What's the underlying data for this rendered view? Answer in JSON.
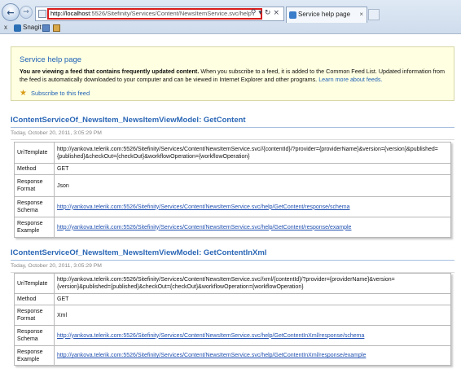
{
  "browser": {
    "address_host": "http://localhost",
    "address_path": ":5526/Sitefinity/Services/Content/NewsItemService.svc/help",
    "tab_title": "Service help page",
    "toolbar_close": "x",
    "snagit_label": "Snagit"
  },
  "banner": {
    "title": "Service help page",
    "text_bold": "You are viewing a feed that contains frequently updated content.",
    "text_rest": " When you subscribe to a feed, it is added to the Common Feed List. Updated information from the feed is automatically downloaded to your computer and can be viewed in Internet Explorer and other programs. ",
    "learn_more": "Learn more about feeds.",
    "subscribe": "Subscribe to this feed"
  },
  "operations": [
    {
      "title": "IContentServiceOf_NewsItem_NewsItemViewModel: GetContent",
      "date": "Today, October 20, 2011, 3:05:29 PM",
      "rows": [
        {
          "key": "UriTemplate",
          "value": "http://yankova.telerik.com:5526/Sitefinity/Services/Content/NewsItemService.svc//{contentId}/?provider={providerName}&version={version}&published={published}&checkOut={checkOut}&workflowOperation={workflowOperation}"
        },
        {
          "key": "Method",
          "value": "GET"
        },
        {
          "key": "Response Format",
          "value": "Json"
        },
        {
          "key": "Response Schema",
          "value": "http://yankova.telerik.com:5526/Sitefinity/Services/Content/NewsItemService.svc/help/GetContent/response/schema"
        },
        {
          "key": "Response Example",
          "value": "http://yankova.telerik.com:5526/Sitefinity/Services/Content/NewsItemService.svc/help/GetContent/response/example"
        }
      ]
    },
    {
      "title": "IContentServiceOf_NewsItem_NewsItemViewModel: GetContentInXml",
      "date": "Today, October 20, 2011, 3:05:29 PM",
      "rows": [
        {
          "key": "UriTemplate",
          "value": "http://yankova.telerik.com:5526/Sitefinity/Services/Content/NewsItemService.svc//xml/{contentId}/?provider={providerName}&version={version}&published={published}&checkOut={checkOut}&workflowOperation={workflowOperation}"
        },
        {
          "key": "Method",
          "value": "GET"
        },
        {
          "key": "Response Format",
          "value": "Xml"
        },
        {
          "key": "Response Schema",
          "value": "http://yankova.telerik.com:5526/Sitefinity/Services/Content/NewsItemService.svc/help/GetContentInXml/response/schema"
        },
        {
          "key": "Response Example",
          "value": "http://yankova.telerik.com:5526/Sitefinity/Services/Content/NewsItemService.svc/help/GetContentInXml/response/example"
        }
      ]
    }
  ],
  "colors": {
    "link": "#1f4fb0",
    "title": "#2b67b6",
    "banner_bg": "#ffffe1",
    "address_highlight": "#d81c1c"
  }
}
